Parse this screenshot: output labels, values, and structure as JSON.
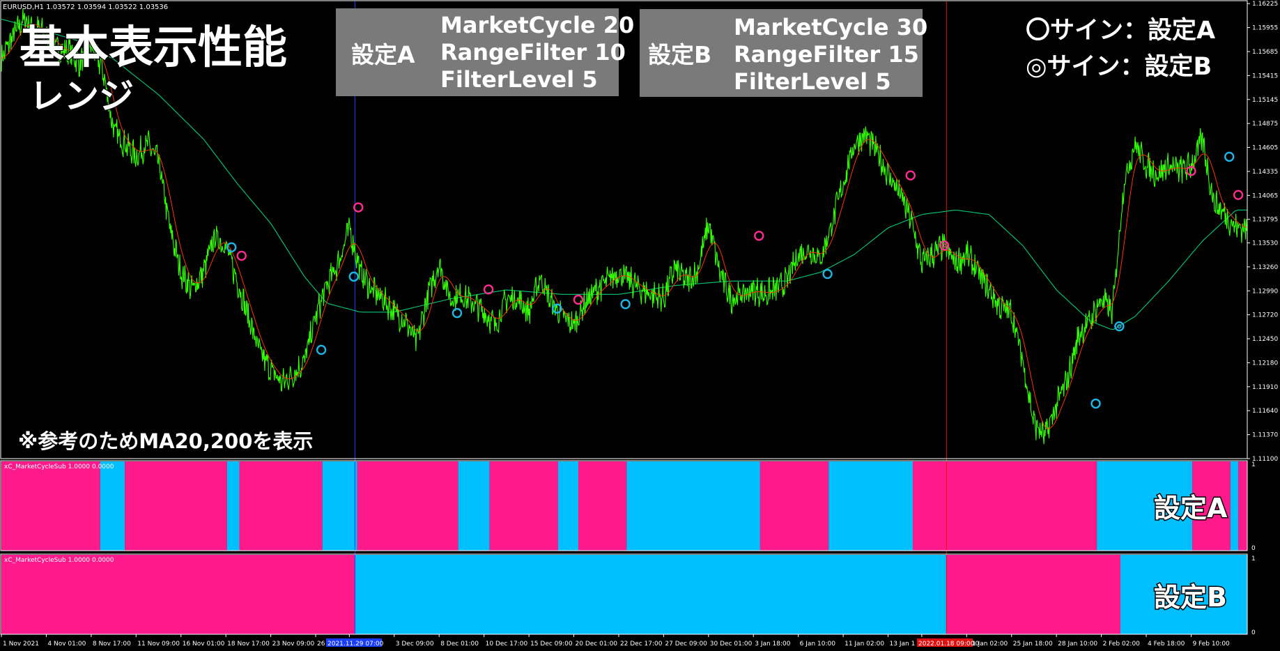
{
  "chart_data": {
    "type": "line",
    "symbol_header": "EURUSD,H1  1.03572 1.03594 1.03522 1.03536",
    "ylim": [
      1.111,
      1.1625
    ],
    "y_ticks": [
      "1.16225",
      "1.15955",
      "1.15685",
      "1.15415",
      "1.15145",
      "1.14875",
      "1.14605",
      "1.14335",
      "1.14065",
      "1.13795",
      "1.13530",
      "1.13260",
      "1.12990",
      "1.12720",
      "1.12450",
      "1.12180",
      "1.11910",
      "1.11640",
      "1.11370",
      "1.11100"
    ],
    "x_ticks": [
      "1 Nov 2021",
      "4 Nov 01:00",
      "8 Nov 17:00",
      "11 Nov 09:00",
      "16 Nov 01:00",
      "18 Nov 17:00",
      "23 Nov 09:00",
      "26 N",
      "17:00",
      "3 Dec 09:00",
      "8 Dec 01:00",
      "10 Dec 17:00",
      "15 Dec 09:00",
      "20 Dec 01:00",
      "22 Dec 17:00",
      "27 Dec 09:00",
      "30 Dec 01:00",
      "3 Jan 18:00",
      "6 Jan 10:00",
      "11 Jan 02:00",
      "13 Jan 1",
      "2022.01.18 09:00",
      "21 Jan 02:00",
      "25 Jan 18:00",
      "28 Jan 10:00",
      "2 Feb 02:00",
      "4 Feb 18:00",
      "9 Feb 10:00"
    ],
    "x_tick_positions": [
      0,
      4,
      8,
      12,
      16,
      20,
      24,
      28,
      31,
      35,
      39,
      43,
      47,
      51,
      55,
      59,
      63,
      67,
      71,
      75,
      79,
      82,
      86,
      90,
      94,
      98,
      102,
      106
    ],
    "price_keyframes": [
      [
        0,
        1.156
      ],
      [
        1,
        1.1585
      ],
      [
        2,
        1.1605
      ],
      [
        3,
        1.1595
      ],
      [
        4,
        1.1588
      ],
      [
        5,
        1.157
      ],
      [
        6,
        1.157
      ],
      [
        7,
        1.1555
      ],
      [
        8,
        1.1575
      ],
      [
        9,
        1.155
      ],
      [
        10,
        1.148
      ],
      [
        11,
        1.1465
      ],
      [
        12,
        1.145
      ],
      [
        13,
        1.1465
      ],
      [
        14,
        1.1445
      ],
      [
        15,
        1.137
      ],
      [
        16,
        1.132
      ],
      [
        17,
        1.13
      ],
      [
        18,
        1.132
      ],
      [
        19,
        1.136
      ],
      [
        20,
        1.135
      ],
      [
        21,
        1.131
      ],
      [
        22,
        1.127
      ],
      [
        23,
        1.123
      ],
      [
        24,
        1.121
      ],
      [
        25,
        1.1195
      ],
      [
        26,
        1.1205
      ],
      [
        27,
        1.122
      ],
      [
        28,
        1.127
      ],
      [
        29,
        1.1305
      ],
      [
        30,
        1.133
      ],
      [
        31,
        1.137
      ],
      [
        32,
        1.132
      ],
      [
        33,
        1.13
      ],
      [
        34,
        1.129
      ],
      [
        35,
        1.1275
      ],
      [
        36,
        1.1265
      ],
      [
        37,
        1.124
      ],
      [
        38,
        1.1295
      ],
      [
        39,
        1.133
      ],
      [
        40,
        1.129
      ],
      [
        41,
        1.1295
      ],
      [
        42,
        1.1285
      ],
      [
        43,
        1.1275
      ],
      [
        44,
        1.126
      ],
      [
        45,
        1.129
      ],
      [
        46,
        1.129
      ],
      [
        47,
        1.1275
      ],
      [
        48,
        1.1315
      ],
      [
        49,
        1.1285
      ],
      [
        50,
        1.127
      ],
      [
        51,
        1.126
      ],
      [
        52,
        1.1285
      ],
      [
        53,
        1.13
      ],
      [
        54,
        1.131
      ],
      [
        55,
        1.132
      ],
      [
        56,
        1.131
      ],
      [
        57,
        1.13
      ],
      [
        58,
        1.1295
      ],
      [
        59,
        1.129
      ],
      [
        60,
        1.1325
      ],
      [
        61,
        1.131
      ],
      [
        62,
        1.132
      ],
      [
        63,
        1.1375
      ],
      [
        64,
        1.132
      ],
      [
        65,
        1.129
      ],
      [
        66,
        1.1295
      ],
      [
        67,
        1.13
      ],
      [
        68,
        1.1295
      ],
      [
        69,
        1.13
      ],
      [
        70,
        1.131
      ],
      [
        71,
        1.134
      ],
      [
        72,
        1.1345
      ],
      [
        73,
        1.1335
      ],
      [
        74,
        1.1375
      ],
      [
        75,
        1.142
      ],
      [
        76,
        1.1465
      ],
      [
        77,
        1.1475
      ],
      [
        78,
        1.1455
      ],
      [
        79,
        1.143
      ],
      [
        80,
        1.141
      ],
      [
        81,
        1.138
      ],
      [
        82,
        1.133
      ],
      [
        83,
        1.134
      ],
      [
        84,
        1.135
      ],
      [
        85,
        1.133
      ],
      [
        86,
        1.134
      ],
      [
        87,
        1.132
      ],
      [
        88,
        1.13
      ],
      [
        89,
        1.128
      ],
      [
        90,
        1.1275
      ],
      [
        91,
        1.122
      ],
      [
        92,
        1.115
      ],
      [
        93,
        1.1135
      ],
      [
        94,
        1.117
      ],
      [
        95,
        1.12
      ],
      [
        96,
        1.125
      ],
      [
        97,
        1.1265
      ],
      [
        98,
        1.129
      ],
      [
        99,
        1.1275
      ],
      [
        100,
        1.142
      ],
      [
        101,
        1.1465
      ],
      [
        102,
        1.144
      ],
      [
        103,
        1.143
      ],
      [
        104,
        1.144
      ],
      [
        105,
        1.1435
      ],
      [
        106,
        1.144
      ],
      [
        107,
        1.147
      ],
      [
        108,
        1.14
      ],
      [
        109,
        1.1385
      ],
      [
        110,
        1.137
      ]
    ],
    "ma200_keyframes": [
      [
        0,
        1.1605
      ],
      [
        3,
        1.1595
      ],
      [
        7,
        1.158
      ],
      [
        10,
        1.156
      ],
      [
        14,
        1.152
      ],
      [
        18,
        1.147
      ],
      [
        21,
        1.142
      ],
      [
        24,
        1.1375
      ],
      [
        27,
        1.1315
      ],
      [
        29,
        1.1285
      ],
      [
        32,
        1.1275
      ],
      [
        35,
        1.1275
      ],
      [
        40,
        1.129
      ],
      [
        45,
        1.13
      ],
      [
        50,
        1.1295
      ],
      [
        55,
        1.1295
      ],
      [
        60,
        1.1305
      ],
      [
        65,
        1.131
      ],
      [
        70,
        1.131
      ],
      [
        73,
        1.132
      ],
      [
        76,
        1.134
      ],
      [
        79,
        1.137
      ],
      [
        82,
        1.1385
      ],
      [
        85,
        1.139
      ],
      [
        88,
        1.1385
      ],
      [
        91,
        1.135
      ],
      [
        94,
        1.13
      ],
      [
        97,
        1.1265
      ],
      [
        99,
        1.1255
      ],
      [
        101,
        1.127
      ],
      [
        104,
        1.131
      ],
      [
        107,
        1.1355
      ],
      [
        110,
        1.139
      ]
    ],
    "signals": [
      {
        "x": 20.5,
        "y": 1.1348,
        "color": "#1eb6e6",
        "double": false
      },
      {
        "x": 21.4,
        "y": 1.13385,
        "color": "#ff2d8f",
        "double": false
      },
      {
        "x": 28.5,
        "y": 1.12325,
        "color": "#1eb6e6",
        "double": false
      },
      {
        "x": 31.4,
        "y": 1.1315,
        "color": "#1eb6e6",
        "double": false
      },
      {
        "x": 31.8,
        "y": 1.1393,
        "color": "#ff2d8f",
        "double": false
      },
      {
        "x": 40.6,
        "y": 1.1274,
        "color": "#1eb6e6",
        "double": false
      },
      {
        "x": 43.4,
        "y": 1.13005,
        "color": "#ff2d8f",
        "double": false
      },
      {
        "x": 49.5,
        "y": 1.1279,
        "color": "#1eb6e6",
        "double": false
      },
      {
        "x": 51.4,
        "y": 1.1289,
        "color": "#ff2d8f",
        "double": false
      },
      {
        "x": 55.6,
        "y": 1.1284,
        "color": "#1eb6e6",
        "double": false
      },
      {
        "x": 67.5,
        "y": 1.1361,
        "color": "#ff2d8f",
        "double": false
      },
      {
        "x": 73.6,
        "y": 1.1318,
        "color": "#1eb6e6",
        "double": false
      },
      {
        "x": 81.0,
        "y": 1.1429,
        "color": "#ff2d8f",
        "double": false
      },
      {
        "x": 84.0,
        "y": 1.135,
        "color": "#ff2d8f",
        "double": true
      },
      {
        "x": 97.5,
        "y": 1.1172,
        "color": "#1eb6e6",
        "double": false
      },
      {
        "x": 99.6,
        "y": 1.1259,
        "color": "#1eb6e6",
        "double": true
      },
      {
        "x": 106.0,
        "y": 1.1434,
        "color": "#ff2d8f",
        "double": false
      },
      {
        "x": 109.4,
        "y": 1.145,
        "color": "#1eb6e6",
        "double": false
      },
      {
        "x": 110.2,
        "y": 1.1407,
        "color": "#ff2d8f",
        "double": false
      }
    ],
    "setting_a_segments": [
      [
        0,
        8.8,
        "#ff1a8c"
      ],
      [
        8.8,
        11.0,
        "#00bfff"
      ],
      [
        11.0,
        20.1,
        "#ff1a8c"
      ],
      [
        20.1,
        21.2,
        "#00bfff"
      ],
      [
        21.2,
        28.6,
        "#ff1a8c"
      ],
      [
        28.6,
        31.7,
        "#00bfff"
      ],
      [
        31.7,
        40.7,
        "#ff1a8c"
      ],
      [
        40.7,
        43.5,
        "#00bfff"
      ],
      [
        43.5,
        49.6,
        "#ff1a8c"
      ],
      [
        49.6,
        51.4,
        "#00bfff"
      ],
      [
        51.4,
        55.7,
        "#ff1a8c"
      ],
      [
        55.7,
        67.6,
        "#00bfff"
      ],
      [
        67.6,
        73.7,
        "#ff1a8c"
      ],
      [
        73.7,
        81.2,
        "#00bfff"
      ],
      [
        81.2,
        97.6,
        "#ff1a8c"
      ],
      [
        97.6,
        106.1,
        "#00bfff"
      ],
      [
        106.1,
        109.5,
        "#ff1a8c"
      ],
      [
        109.5,
        110.2,
        "#00bfff"
      ],
      [
        110.2,
        111,
        "#ff1a8c"
      ]
    ],
    "setting_b_segments": [
      [
        0,
        31.5,
        "#ff1a8c"
      ],
      [
        31.5,
        84.2,
        "#00bfff"
      ],
      [
        84.2,
        99.7,
        "#ff1a8c"
      ],
      [
        99.7,
        111,
        "#00bfff"
      ]
    ],
    "vlines": [
      {
        "x": 31.5,
        "color": "#1a3cff"
      },
      {
        "x": 84.2,
        "color": "#e01010"
      }
    ],
    "sub_label": "xC_MarketCycleSub 1.0000 0.0000",
    "sub_ticks": [
      "1",
      "0"
    ],
    "highlight_a": "2021.11.29 07:00",
    "highlight_b": "2022.01.18 09:00",
    "colors": {
      "price": "#33ff00",
      "ma20": "#ff3300",
      "ma200": "#00cc77",
      "pink": "#ff1a8c",
      "cyan": "#00bfff"
    }
  },
  "overlay": {
    "title": "基本表示性能",
    "subtitle": "レンジ",
    "note": "※参考のためMA20,200を表示",
    "box_a": {
      "label": "設定A",
      "line1": "MarketCycle 20",
      "line2": "RangeFilter 10",
      "line3": "FilterLevel 5"
    },
    "box_b": {
      "label": "設定B",
      "line1": "MarketCycle 30",
      "line2": "RangeFilter 15",
      "line3": "FilterLevel 5"
    },
    "legend_a": "〇サイン：設定A",
    "legend_b": "◎サイン：設定B",
    "panel_a_label": "設定A",
    "panel_b_label": "設定B"
  }
}
